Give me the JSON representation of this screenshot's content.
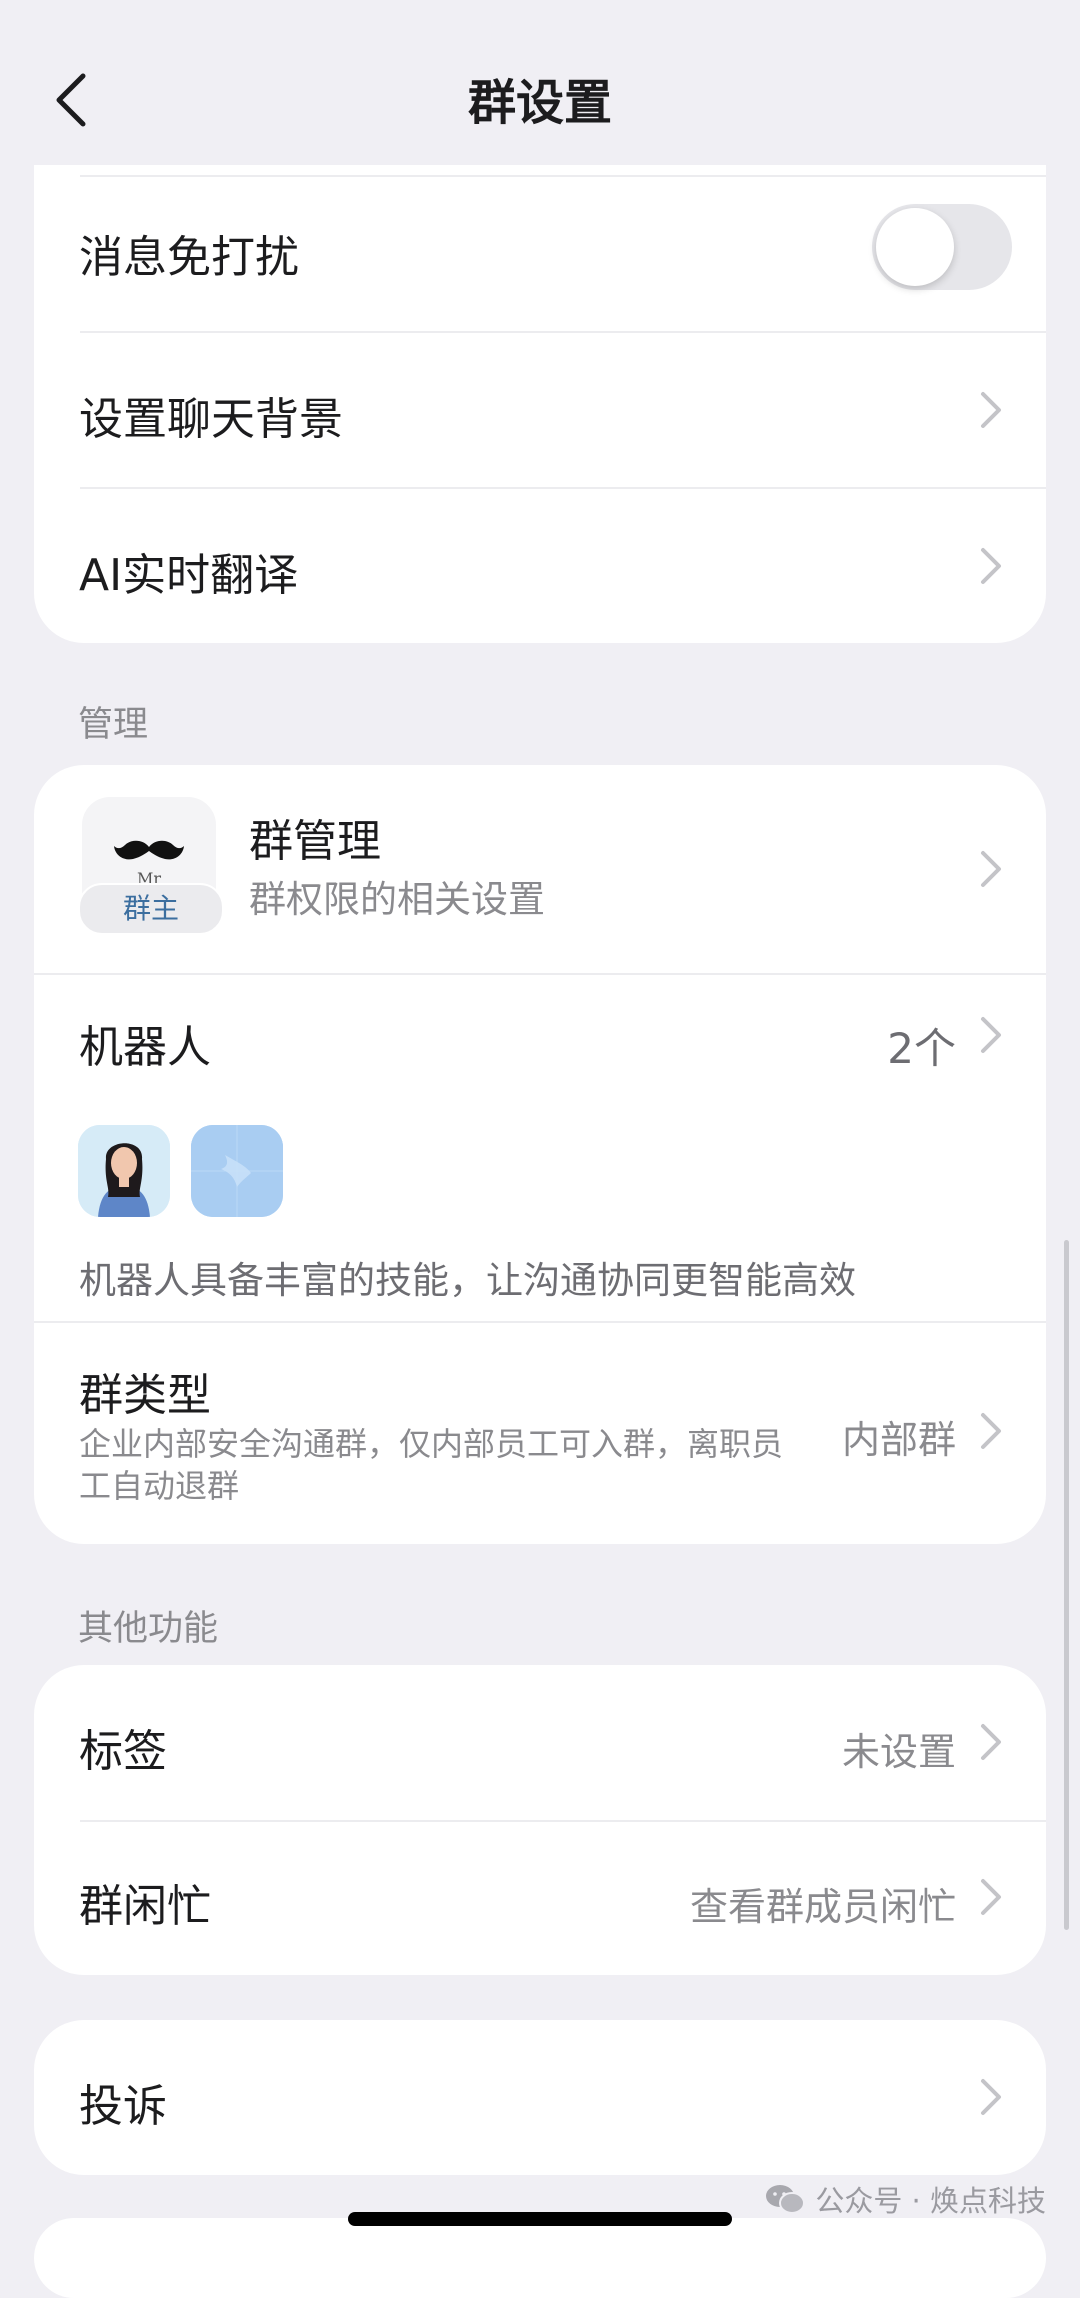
{
  "nav": {
    "title": "群设置",
    "back_icon": "chevron-left-icon"
  },
  "settings": {
    "mute_label": "消息免打扰",
    "mute_on": false,
    "background_label": "设置聊天背景",
    "translate_label": "AI实时翻译"
  },
  "management": {
    "section_title": "管理",
    "group_manage": {
      "title": "群管理",
      "subtitle": "群权限的相关设置",
      "avatar_text": "Mr",
      "owner_badge": "群主"
    },
    "robots": {
      "title": "机器人",
      "count": "2个",
      "description": "机器人具备丰富的技能，让沟通协同更智能高效",
      "avatars": [
        "robot-woman-avatar",
        "robot-bird-avatar"
      ]
    },
    "group_type": {
      "title": "群类型",
      "description": "企业内部安全沟通群，仅内部员工可入群，离职员工自动退群",
      "value": "内部群"
    }
  },
  "other": {
    "section_title": "其他功能",
    "tags": {
      "label": "标签",
      "value": "未设置"
    },
    "busy": {
      "label": "群闲忙",
      "value": "查看群成员闲忙"
    }
  },
  "report": {
    "label": "投诉"
  },
  "watermark": {
    "text": "公众号 · 焕点科技",
    "icon": "wechat-icon"
  },
  "colors": {
    "background": "#f0eff4",
    "card": "#ffffff",
    "secondary_text": "#8a8a8e",
    "owner_badge_text": "#3b6e9f",
    "robot_bg": "#a9cdf2"
  }
}
